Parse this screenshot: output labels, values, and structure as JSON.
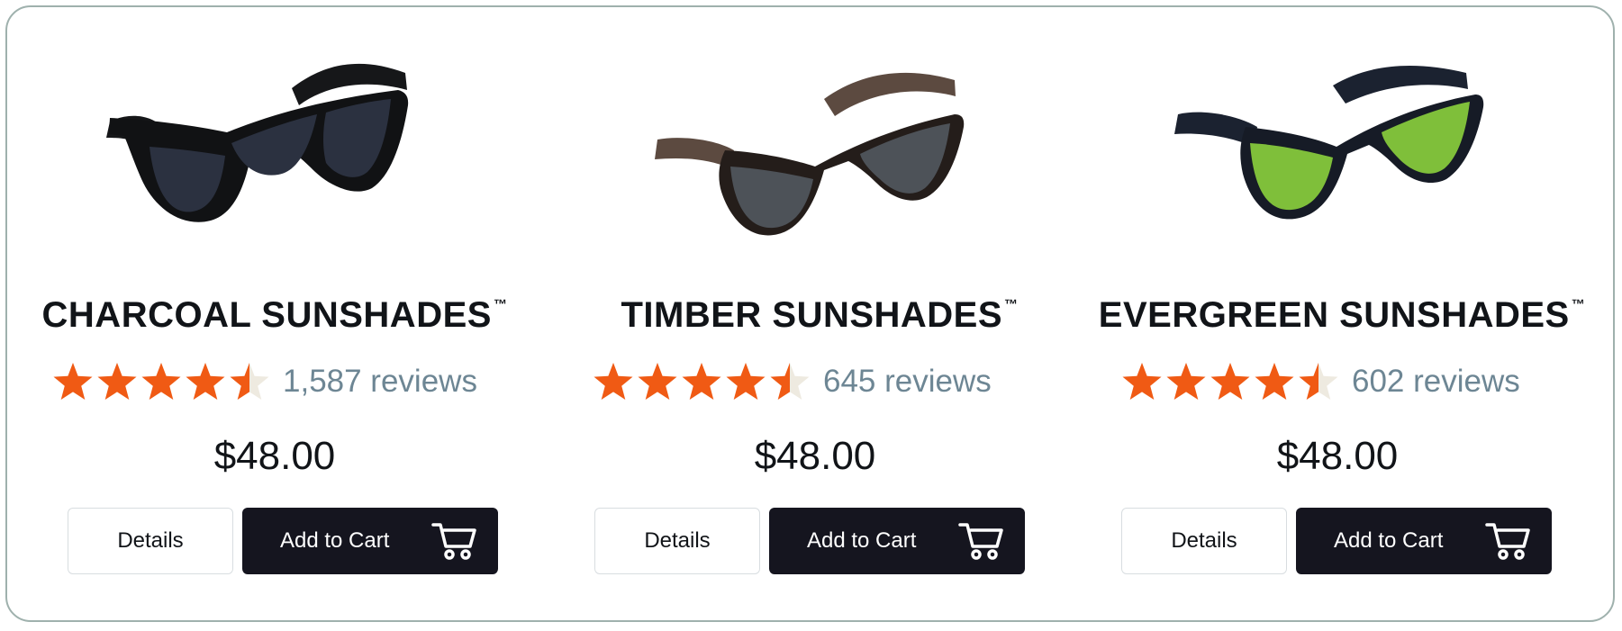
{
  "products": [
    {
      "name": "CHARCOAL SUNSHADES",
      "trademark": "™",
      "rating": 4.5,
      "reviews": "1,587 reviews",
      "price": "$48.00",
      "details_label": "Details",
      "cart_label": "Add to Cart",
      "lens_color": "#2b3140",
      "frame_color": "#111214",
      "arm_color": "#161719"
    },
    {
      "name": "TIMBER SUNSHADES",
      "trademark": "™",
      "rating": 4.5,
      "reviews": "645 reviews",
      "price": "$48.00",
      "details_label": "Details",
      "cart_label": "Add to Cart",
      "lens_color": "#4d5258",
      "frame_color": "#241d1a",
      "arm_color": "#5c4a40"
    },
    {
      "name": "EVERGREEN SUNSHADES",
      "trademark": "™",
      "rating": 4.5,
      "reviews": "602 reviews",
      "price": "$48.00",
      "details_label": "Details",
      "cart_label": "Add to Cart",
      "lens_color": "#7fbf3a",
      "frame_color": "#161b26",
      "arm_color": "#1b2230"
    }
  ],
  "colors": {
    "star_fill": "#f05a14",
    "star_empty": "#eeeae0",
    "review_text": "#6d8694",
    "button_dark": "#15151f",
    "border": "#9fb1ad"
  },
  "icons": {
    "star": "star-icon",
    "cart": "cart-icon"
  }
}
